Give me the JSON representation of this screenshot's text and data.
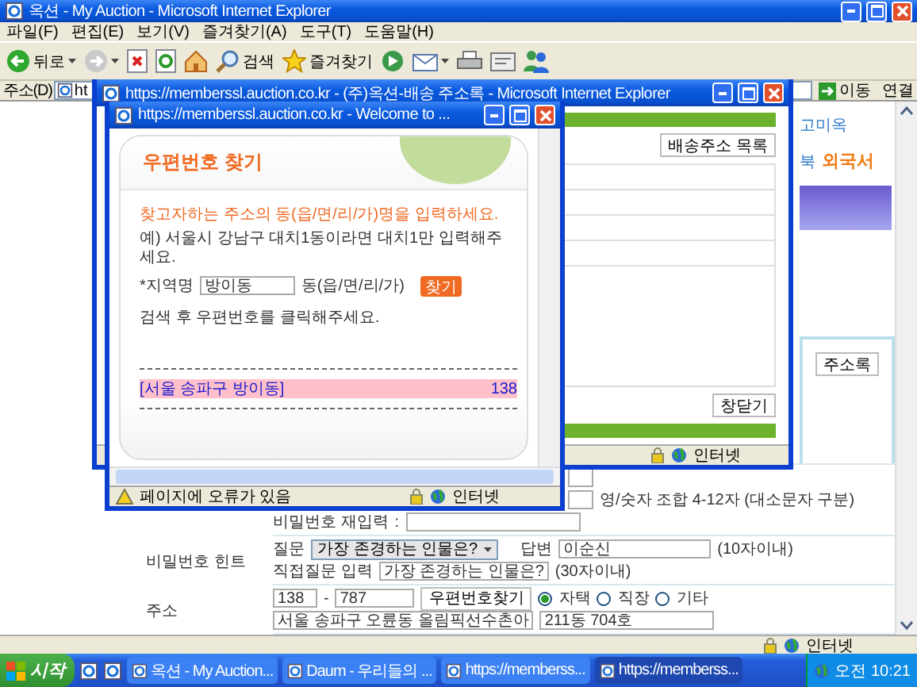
{
  "main_window": {
    "title": "옥션 - My Auction - Microsoft Internet Explorer",
    "menu": [
      "파일(F)",
      "편집(E)",
      "보기(V)",
      "즐겨찾기(A)",
      "도구(T)",
      "도움말(H)"
    ],
    "toolbar": [
      {
        "kind": "back",
        "label": "뒤로"
      },
      {
        "kind": "forward"
      },
      {
        "kind": "stop"
      },
      {
        "kind": "refresh"
      },
      {
        "kind": "home"
      },
      {
        "kind": "search",
        "label": "검색"
      },
      {
        "kind": "favorites",
        "label": "즐겨찾기"
      },
      {
        "kind": "media"
      },
      {
        "kind": "mail"
      },
      {
        "kind": "print"
      },
      {
        "kind": "edit"
      },
      {
        "kind": "messenger"
      }
    ],
    "address": {
      "label": "주소(D)",
      "value": "ht",
      "go": "이동",
      "links": "연결"
    },
    "page": {
      "top_link": "고미옥",
      "nav": [
        "북",
        "외국서"
      ],
      "address_book_button": "주소록",
      "pw_rule": "영/숫자 조합 4-12자 (대소문자 구분)",
      "pw_confirm_label": "비밀번호 재입력",
      "colon": ":",
      "hint_label": "비밀번호 힌트",
      "question_label": "질문",
      "question_value": "가장 존경하는 인물은?",
      "answer_label": "답변",
      "answer_value": "이순신",
      "answer_limit": "(10자이내)",
      "custom_label": "직접질문 입력",
      "custom_value": "가장 존경하는 인물은?",
      "custom_limit": "(30자이내)",
      "address_label": "주소",
      "zip1": "138",
      "dash": "-",
      "zip2": "787",
      "zip_button": "우편번호찾기",
      "address_types": [
        {
          "label": "자택",
          "selected": true
        },
        {
          "label": "직장",
          "selected": false
        },
        {
          "label": "기타",
          "selected": false
        }
      ],
      "address1": "서울 송파구 오륜동 올림픽선수촌아",
      "address2": "211동 704호"
    },
    "status": {
      "zone": "인터넷"
    }
  },
  "address_book_window": {
    "title": "https://memberssl.auction.co.kr - (주)옥션-배송 주소록 - Microsoft Internet Explorer",
    "list_button": "배송주소 목록",
    "close_button": "창닫기",
    "status": {
      "zone": "인터넷"
    }
  },
  "zipcode_window": {
    "title": "https://memberssl.auction.co.kr - Welcome to ...",
    "heading": "우편번호 찾기",
    "instruction": "찾고자하는 주소의 동(읍/면/리/가)명을 입력하세요.",
    "example": "예) 서울시 강남구 대치1동이라면 대치1만 입력해주세요.",
    "field_label": "*지역명",
    "field_value": "방이동",
    "field_suffix": "동(읍/면/리/가)",
    "search_button": "찾기",
    "hint": "검색 후 우편번호를 클릭해주세요.",
    "results": [
      {
        "address": "[서울 송파구 방이동]",
        "code": "138",
        "selected": true
      }
    ],
    "status": {
      "message": "페이지에 오류가 있음",
      "zone": "인터넷"
    }
  },
  "taskbar": {
    "start": "시작",
    "tasks": [
      {
        "label": "옥션 - My Auction...",
        "selected": false
      },
      {
        "label": "Daum - 우리들의 ...",
        "selected": false
      },
      {
        "label": "https://memberss...",
        "selected": false
      },
      {
        "label": "https://memberss...",
        "selected": true
      }
    ],
    "clock": "오전 10:21"
  }
}
